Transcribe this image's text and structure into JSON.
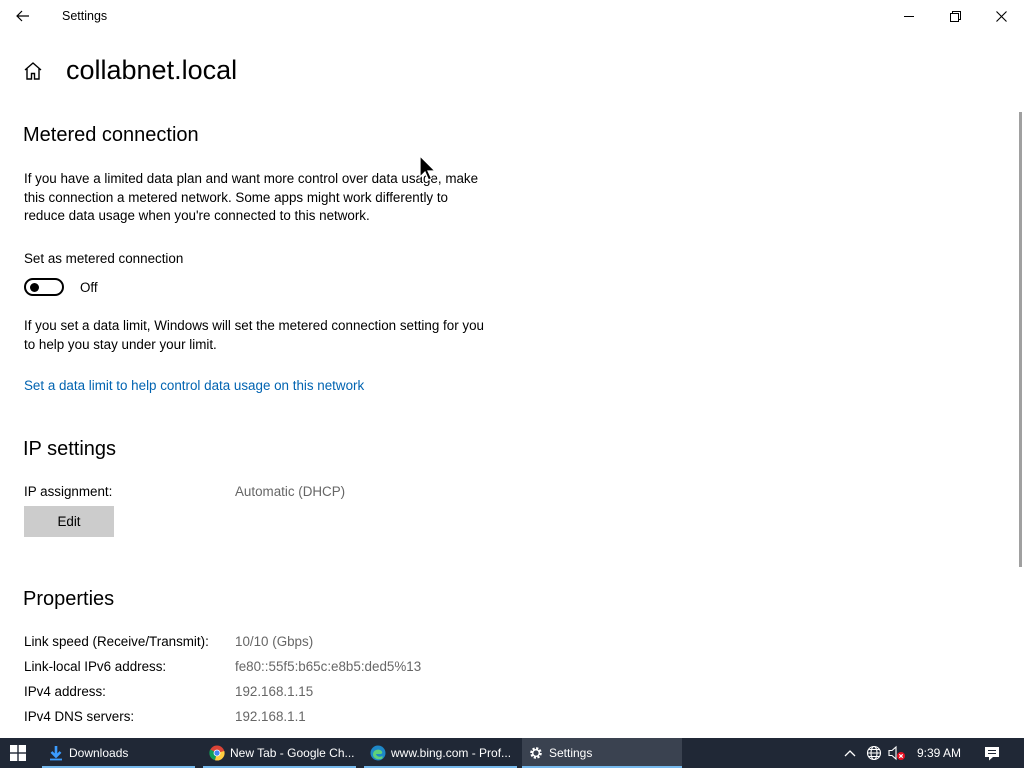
{
  "window": {
    "title": "Settings"
  },
  "header": {
    "title": "collabnet.local"
  },
  "metered": {
    "heading": "Metered connection",
    "description": "If you have a limited data plan and want more control over data usage, make this connection a metered network. Some apps might work differently to reduce data usage when you're connected to this network.",
    "toggle_label": "Set as metered connection",
    "toggle_state": "Off",
    "toggle_on": false,
    "limit_note": "If you set a data limit, Windows will set the metered connection setting for you to help you stay under your limit.",
    "limit_link": "Set a data limit to help control data usage on this network"
  },
  "ip": {
    "heading": "IP settings",
    "assignment_label": "IP assignment:",
    "assignment_value": "Automatic (DHCP)",
    "edit_label": "Edit"
  },
  "properties": {
    "heading": "Properties",
    "rows": [
      {
        "label": "Link speed (Receive/Transmit):",
        "value": "10/10 (Gbps)"
      },
      {
        "label": "Link-local IPv6 address:",
        "value": "fe80::55f5:b65c:e8b5:ded5%13"
      },
      {
        "label": "IPv4 address:",
        "value": "192.168.1.15"
      },
      {
        "label": "IPv4 DNS servers:",
        "value": "192.168.1.1"
      }
    ]
  },
  "taskbar": {
    "items": [
      {
        "label": "Downloads",
        "icon": "download-arrow-icon",
        "active": false
      },
      {
        "label": "New Tab - Google Ch...",
        "icon": "chrome-icon",
        "active": false
      },
      {
        "label": "www.bing.com - Prof...",
        "icon": "edge-icon",
        "active": false
      },
      {
        "label": "Settings",
        "icon": "gear-icon",
        "active": true
      }
    ],
    "clock": "9:39 AM"
  },
  "colors": {
    "accent_link": "#0063b1",
    "taskbar_bg": "#202836",
    "taskbar_active": "#3a4250",
    "taskbar_underline": "#76b9ed"
  }
}
